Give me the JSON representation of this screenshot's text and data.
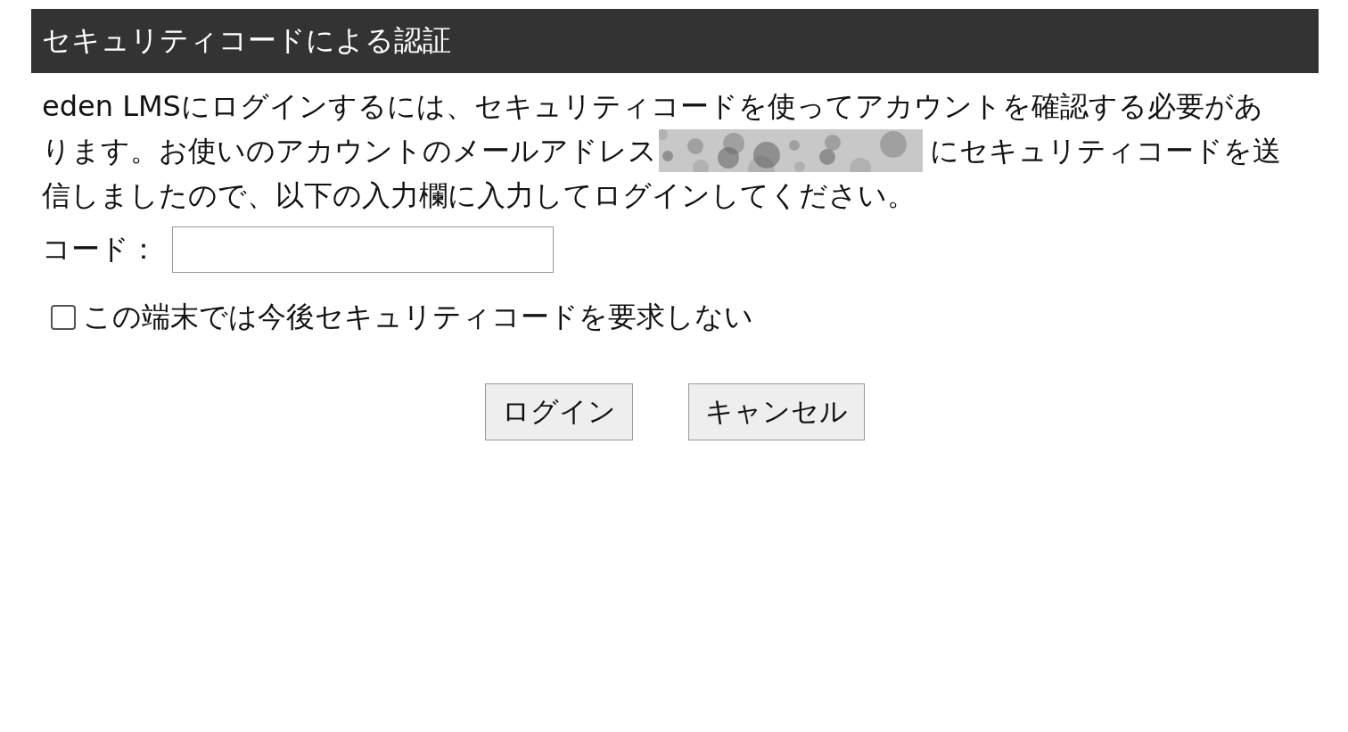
{
  "header": {
    "title": "セキュリティコードによる認証"
  },
  "message": {
    "lines": [
      {
        "text": "eden LMSにログインするには、セキュリティコードを使ってアカウントを確認する必要があ"
      },
      {
        "text": "ります。お使いのアカウントのメールアドレス",
        "email_redacted": true,
        "after": "にセキュリティコードを送"
      },
      {
        "text": "信しましたので、以下の入力欄に入力してログインしてください。"
      }
    ]
  },
  "code_field": {
    "label": "コード："
  },
  "remember": {
    "label": "この端末では今後セキュリティコードを要求しない",
    "checked": false
  },
  "buttons": [
    {
      "label": "ログイン"
    },
    {
      "label": "キャンセル"
    }
  ]
}
